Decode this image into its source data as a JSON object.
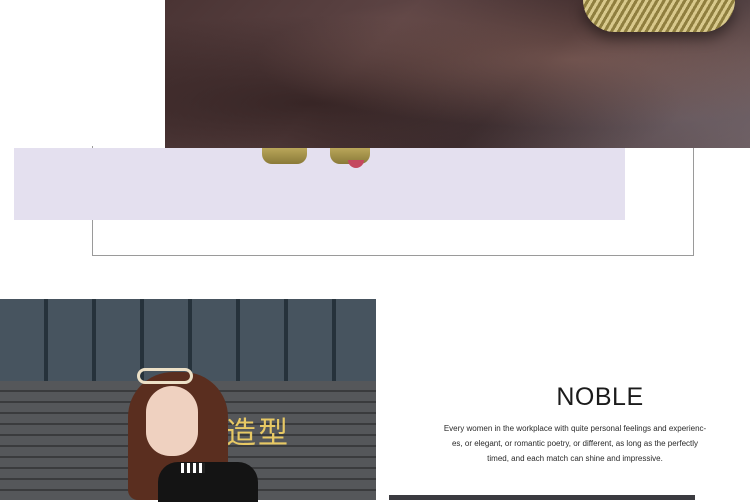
{
  "sign": {
    "text": "造型"
  },
  "section": {
    "headline": "NOBLE",
    "lines": [
      "Every women in the workplace with quite personal feelings and experienc-",
      "es, or elegant, or romantic poetry, or different, as long as the perfectly",
      "timed, and each match can shine and impressive."
    ]
  },
  "colors": {
    "panel": "#e4e0ef",
    "sign_gold": "#e8c964",
    "headline": "#1b1b1b"
  }
}
